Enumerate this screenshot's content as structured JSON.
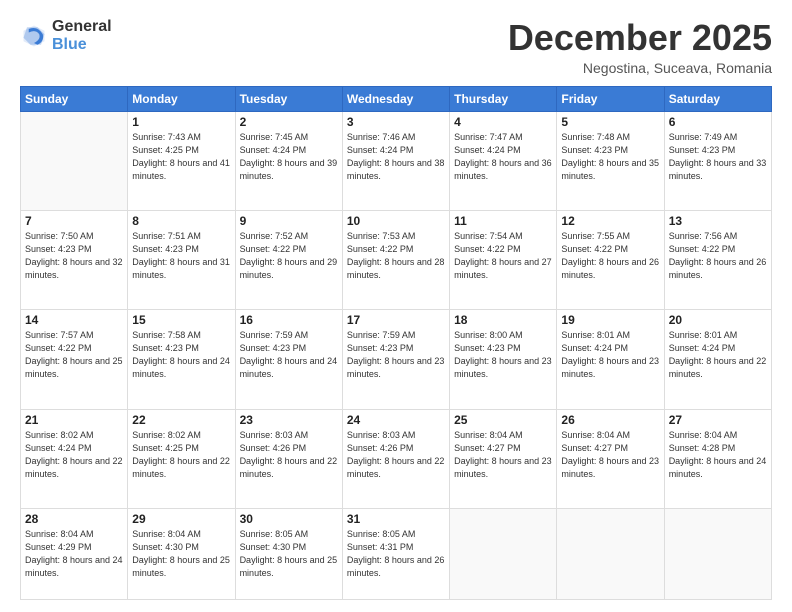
{
  "header": {
    "logo_line1": "General",
    "logo_line2": "Blue",
    "month": "December 2025",
    "location": "Negostina, Suceava, Romania"
  },
  "weekdays": [
    "Sunday",
    "Monday",
    "Tuesday",
    "Wednesday",
    "Thursday",
    "Friday",
    "Saturday"
  ],
  "weeks": [
    [
      {
        "day": "",
        "sunrise": "",
        "sunset": "",
        "daylight": ""
      },
      {
        "day": "1",
        "sunrise": "Sunrise: 7:43 AM",
        "sunset": "Sunset: 4:25 PM",
        "daylight": "Daylight: 8 hours and 41 minutes."
      },
      {
        "day": "2",
        "sunrise": "Sunrise: 7:45 AM",
        "sunset": "Sunset: 4:24 PM",
        "daylight": "Daylight: 8 hours and 39 minutes."
      },
      {
        "day": "3",
        "sunrise": "Sunrise: 7:46 AM",
        "sunset": "Sunset: 4:24 PM",
        "daylight": "Daylight: 8 hours and 38 minutes."
      },
      {
        "day": "4",
        "sunrise": "Sunrise: 7:47 AM",
        "sunset": "Sunset: 4:24 PM",
        "daylight": "Daylight: 8 hours and 36 minutes."
      },
      {
        "day": "5",
        "sunrise": "Sunrise: 7:48 AM",
        "sunset": "Sunset: 4:23 PM",
        "daylight": "Daylight: 8 hours and 35 minutes."
      },
      {
        "day": "6",
        "sunrise": "Sunrise: 7:49 AM",
        "sunset": "Sunset: 4:23 PM",
        "daylight": "Daylight: 8 hours and 33 minutes."
      }
    ],
    [
      {
        "day": "7",
        "sunrise": "Sunrise: 7:50 AM",
        "sunset": "Sunset: 4:23 PM",
        "daylight": "Daylight: 8 hours and 32 minutes."
      },
      {
        "day": "8",
        "sunrise": "Sunrise: 7:51 AM",
        "sunset": "Sunset: 4:23 PM",
        "daylight": "Daylight: 8 hours and 31 minutes."
      },
      {
        "day": "9",
        "sunrise": "Sunrise: 7:52 AM",
        "sunset": "Sunset: 4:22 PM",
        "daylight": "Daylight: 8 hours and 29 minutes."
      },
      {
        "day": "10",
        "sunrise": "Sunrise: 7:53 AM",
        "sunset": "Sunset: 4:22 PM",
        "daylight": "Daylight: 8 hours and 28 minutes."
      },
      {
        "day": "11",
        "sunrise": "Sunrise: 7:54 AM",
        "sunset": "Sunset: 4:22 PM",
        "daylight": "Daylight: 8 hours and 27 minutes."
      },
      {
        "day": "12",
        "sunrise": "Sunrise: 7:55 AM",
        "sunset": "Sunset: 4:22 PM",
        "daylight": "Daylight: 8 hours and 26 minutes."
      },
      {
        "day": "13",
        "sunrise": "Sunrise: 7:56 AM",
        "sunset": "Sunset: 4:22 PM",
        "daylight": "Daylight: 8 hours and 26 minutes."
      }
    ],
    [
      {
        "day": "14",
        "sunrise": "Sunrise: 7:57 AM",
        "sunset": "Sunset: 4:22 PM",
        "daylight": "Daylight: 8 hours and 25 minutes."
      },
      {
        "day": "15",
        "sunrise": "Sunrise: 7:58 AM",
        "sunset": "Sunset: 4:23 PM",
        "daylight": "Daylight: 8 hours and 24 minutes."
      },
      {
        "day": "16",
        "sunrise": "Sunrise: 7:59 AM",
        "sunset": "Sunset: 4:23 PM",
        "daylight": "Daylight: 8 hours and 24 minutes."
      },
      {
        "day": "17",
        "sunrise": "Sunrise: 7:59 AM",
        "sunset": "Sunset: 4:23 PM",
        "daylight": "Daylight: 8 hours and 23 minutes."
      },
      {
        "day": "18",
        "sunrise": "Sunrise: 8:00 AM",
        "sunset": "Sunset: 4:23 PM",
        "daylight": "Daylight: 8 hours and 23 minutes."
      },
      {
        "day": "19",
        "sunrise": "Sunrise: 8:01 AM",
        "sunset": "Sunset: 4:24 PM",
        "daylight": "Daylight: 8 hours and 23 minutes."
      },
      {
        "day": "20",
        "sunrise": "Sunrise: 8:01 AM",
        "sunset": "Sunset: 4:24 PM",
        "daylight": "Daylight: 8 hours and 22 minutes."
      }
    ],
    [
      {
        "day": "21",
        "sunrise": "Sunrise: 8:02 AM",
        "sunset": "Sunset: 4:24 PM",
        "daylight": "Daylight: 8 hours and 22 minutes."
      },
      {
        "day": "22",
        "sunrise": "Sunrise: 8:02 AM",
        "sunset": "Sunset: 4:25 PM",
        "daylight": "Daylight: 8 hours and 22 minutes."
      },
      {
        "day": "23",
        "sunrise": "Sunrise: 8:03 AM",
        "sunset": "Sunset: 4:26 PM",
        "daylight": "Daylight: 8 hours and 22 minutes."
      },
      {
        "day": "24",
        "sunrise": "Sunrise: 8:03 AM",
        "sunset": "Sunset: 4:26 PM",
        "daylight": "Daylight: 8 hours and 22 minutes."
      },
      {
        "day": "25",
        "sunrise": "Sunrise: 8:04 AM",
        "sunset": "Sunset: 4:27 PM",
        "daylight": "Daylight: 8 hours and 23 minutes."
      },
      {
        "day": "26",
        "sunrise": "Sunrise: 8:04 AM",
        "sunset": "Sunset: 4:27 PM",
        "daylight": "Daylight: 8 hours and 23 minutes."
      },
      {
        "day": "27",
        "sunrise": "Sunrise: 8:04 AM",
        "sunset": "Sunset: 4:28 PM",
        "daylight": "Daylight: 8 hours and 24 minutes."
      }
    ],
    [
      {
        "day": "28",
        "sunrise": "Sunrise: 8:04 AM",
        "sunset": "Sunset: 4:29 PM",
        "daylight": "Daylight: 8 hours and 24 minutes."
      },
      {
        "day": "29",
        "sunrise": "Sunrise: 8:04 AM",
        "sunset": "Sunset: 4:30 PM",
        "daylight": "Daylight: 8 hours and 25 minutes."
      },
      {
        "day": "30",
        "sunrise": "Sunrise: 8:05 AM",
        "sunset": "Sunset: 4:30 PM",
        "daylight": "Daylight: 8 hours and 25 minutes."
      },
      {
        "day": "31",
        "sunrise": "Sunrise: 8:05 AM",
        "sunset": "Sunset: 4:31 PM",
        "daylight": "Daylight: 8 hours and 26 minutes."
      },
      {
        "day": "",
        "sunrise": "",
        "sunset": "",
        "daylight": ""
      },
      {
        "day": "",
        "sunrise": "",
        "sunset": "",
        "daylight": ""
      },
      {
        "day": "",
        "sunrise": "",
        "sunset": "",
        "daylight": ""
      }
    ]
  ]
}
